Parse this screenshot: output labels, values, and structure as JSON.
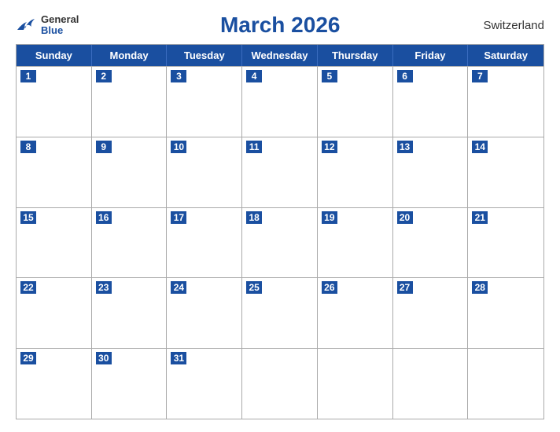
{
  "header": {
    "logo": {
      "general": "General",
      "blue": "Blue"
    },
    "title": "March 2026",
    "country": "Switzerland"
  },
  "calendar": {
    "days_of_week": [
      "Sunday",
      "Monday",
      "Tuesday",
      "Wednesday",
      "Thursday",
      "Friday",
      "Saturday"
    ],
    "weeks": [
      [
        {
          "day": 1,
          "empty": false
        },
        {
          "day": 2,
          "empty": false
        },
        {
          "day": 3,
          "empty": false
        },
        {
          "day": 4,
          "empty": false
        },
        {
          "day": 5,
          "empty": false
        },
        {
          "day": 6,
          "empty": false
        },
        {
          "day": 7,
          "empty": false
        }
      ],
      [
        {
          "day": 8,
          "empty": false
        },
        {
          "day": 9,
          "empty": false
        },
        {
          "day": 10,
          "empty": false
        },
        {
          "day": 11,
          "empty": false
        },
        {
          "day": 12,
          "empty": false
        },
        {
          "day": 13,
          "empty": false
        },
        {
          "day": 14,
          "empty": false
        }
      ],
      [
        {
          "day": 15,
          "empty": false
        },
        {
          "day": 16,
          "empty": false
        },
        {
          "day": 17,
          "empty": false
        },
        {
          "day": 18,
          "empty": false
        },
        {
          "day": 19,
          "empty": false
        },
        {
          "day": 20,
          "empty": false
        },
        {
          "day": 21,
          "empty": false
        }
      ],
      [
        {
          "day": 22,
          "empty": false
        },
        {
          "day": 23,
          "empty": false
        },
        {
          "day": 24,
          "empty": false
        },
        {
          "day": 25,
          "empty": false
        },
        {
          "day": 26,
          "empty": false
        },
        {
          "day": 27,
          "empty": false
        },
        {
          "day": 28,
          "empty": false
        }
      ],
      [
        {
          "day": 29,
          "empty": false
        },
        {
          "day": 30,
          "empty": false
        },
        {
          "day": 31,
          "empty": false
        },
        {
          "day": null,
          "empty": true
        },
        {
          "day": null,
          "empty": true
        },
        {
          "day": null,
          "empty": true
        },
        {
          "day": null,
          "empty": true
        }
      ]
    ]
  }
}
